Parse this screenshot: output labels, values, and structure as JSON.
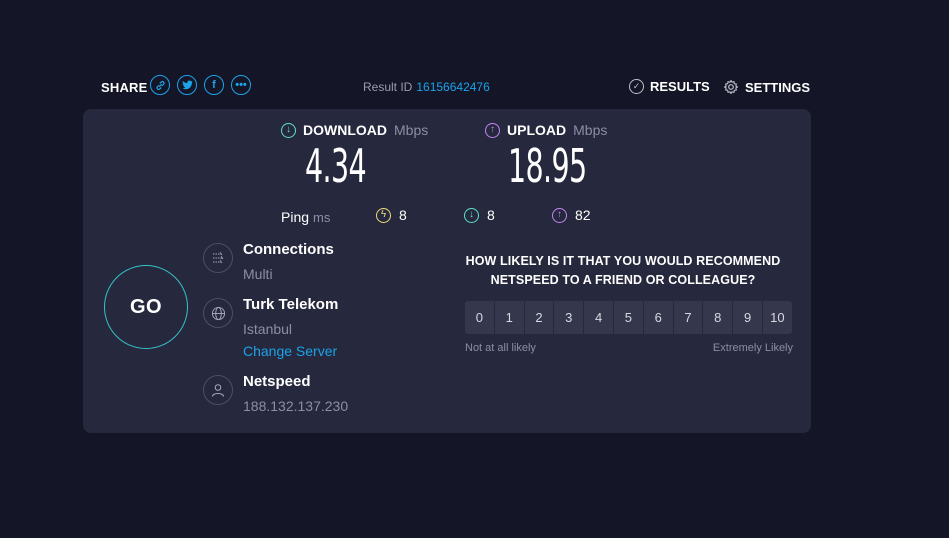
{
  "topbar": {
    "share_label": "SHARE",
    "share_icons": [
      "link-icon",
      "twitter-icon",
      "facebook-icon",
      "more-icon"
    ],
    "result_label": "Result ID",
    "result_id": "16156642476",
    "results_label": "RESULTS",
    "settings_label": "SETTINGS"
  },
  "download": {
    "label": "DOWNLOAD",
    "unit": "Mbps",
    "value": "4.34"
  },
  "upload": {
    "label": "UPLOAD",
    "unit": "Mbps",
    "value": "18.95"
  },
  "ping": {
    "label": "Ping",
    "unit": "ms",
    "idle": "8",
    "download": "8",
    "upload": "82"
  },
  "go_label": "GO",
  "connections": {
    "title": "Connections",
    "value": "Multi"
  },
  "server": {
    "title": "Turk Telekom",
    "location": "Istanbul",
    "change_label": "Change Server"
  },
  "provider": {
    "title": "Netspeed",
    "ip": "188.132.137.230"
  },
  "survey": {
    "question_line1": "HOW LIKELY IS IT THAT YOU WOULD RECOMMEND",
    "question_line2": "NETSPEED TO A FRIEND OR COLLEAGUE?",
    "scale": [
      "0",
      "1",
      "2",
      "3",
      "4",
      "5",
      "6",
      "7",
      "8",
      "9",
      "10"
    ],
    "low_label": "Not at all likely",
    "high_label": "Extremely Likely"
  },
  "colors": {
    "background": "#141526",
    "panel": "#26283d",
    "accent": "#1ba3e8",
    "download": "#5fe0cf",
    "upload": "#c385f5",
    "ping": "#f0dc7a",
    "go_ring": "#35c1c5"
  }
}
